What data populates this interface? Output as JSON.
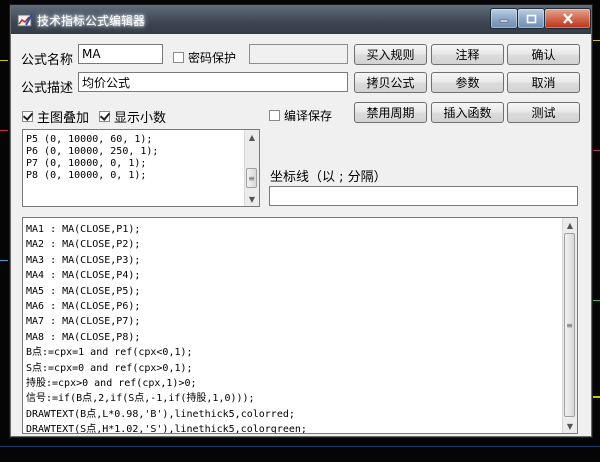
{
  "window": {
    "title": "技术指标公式编辑器",
    "controls": {
      "minimize": "—",
      "maximize": "□",
      "close": "✕"
    }
  },
  "form": {
    "name_label": "公式名称",
    "name_value": "MA",
    "password_label": "密码保护",
    "password_checked": false,
    "desc_label": "公式描述",
    "desc_value": "均价公式",
    "overlay_label": "主图叠加",
    "overlay_checked": true,
    "decimals_label": "显示小数",
    "decimals_checked": true,
    "compile_save_label": "编译保存",
    "compile_save_checked": false,
    "coord_label": "坐标线（以 ; 分隔）",
    "coord_value": ""
  },
  "buttons": {
    "buy_rules": "买入规则",
    "comment": "注释",
    "confirm": "确认",
    "copy_formula": "拷贝公式",
    "params": "参数",
    "cancel": "取消",
    "disable_period": "禁用周期",
    "insert_function": "插入函数",
    "test": "测试"
  },
  "params_lines": [
    "P5 (0, 10000, 60, 1);",
    "P6 (0, 10000, 250, 1);",
    "P7 (0, 10000, 0, 1);",
    "P8 (0, 10000, 0, 1);"
  ],
  "code_lines": [
    "MA1 : MA(CLOSE,P1);",
    "MA2 : MA(CLOSE,P2);",
    "MA3 : MA(CLOSE,P3);",
    "MA4 : MA(CLOSE,P4);",
    "MA5 : MA(CLOSE,P5);",
    "MA6 : MA(CLOSE,P6);",
    "MA7 : MA(CLOSE,P7);",
    "MA8 : MA(CLOSE,P8);",
    "B点:=cpx=1 and ref(cpx<0,1);",
    "S点:=cpx=0 and ref(cpx>0,1);",
    "持股:=cpx>0 and ref(cpx,1)>0;",
    "信号:=if(B点,2,if(S点,-1,if(持股,1,0)));",
    "DRAWTEXT(B点,L*0.98,'B'),linethick5,colorred;",
    "DRAWTEXT(S点,H*1.02,'S'),linethick5,colorgreen;"
  ],
  "icons": {
    "app": "chart-pencil-icon",
    "scroll_up": "▲",
    "scroll_down": "▼",
    "grip": "≡"
  },
  "colors": {
    "titlebar": "#3c4552",
    "close_button": "#c9452a",
    "window_bg": "#f0f0f0",
    "desktop": "#050505"
  }
}
